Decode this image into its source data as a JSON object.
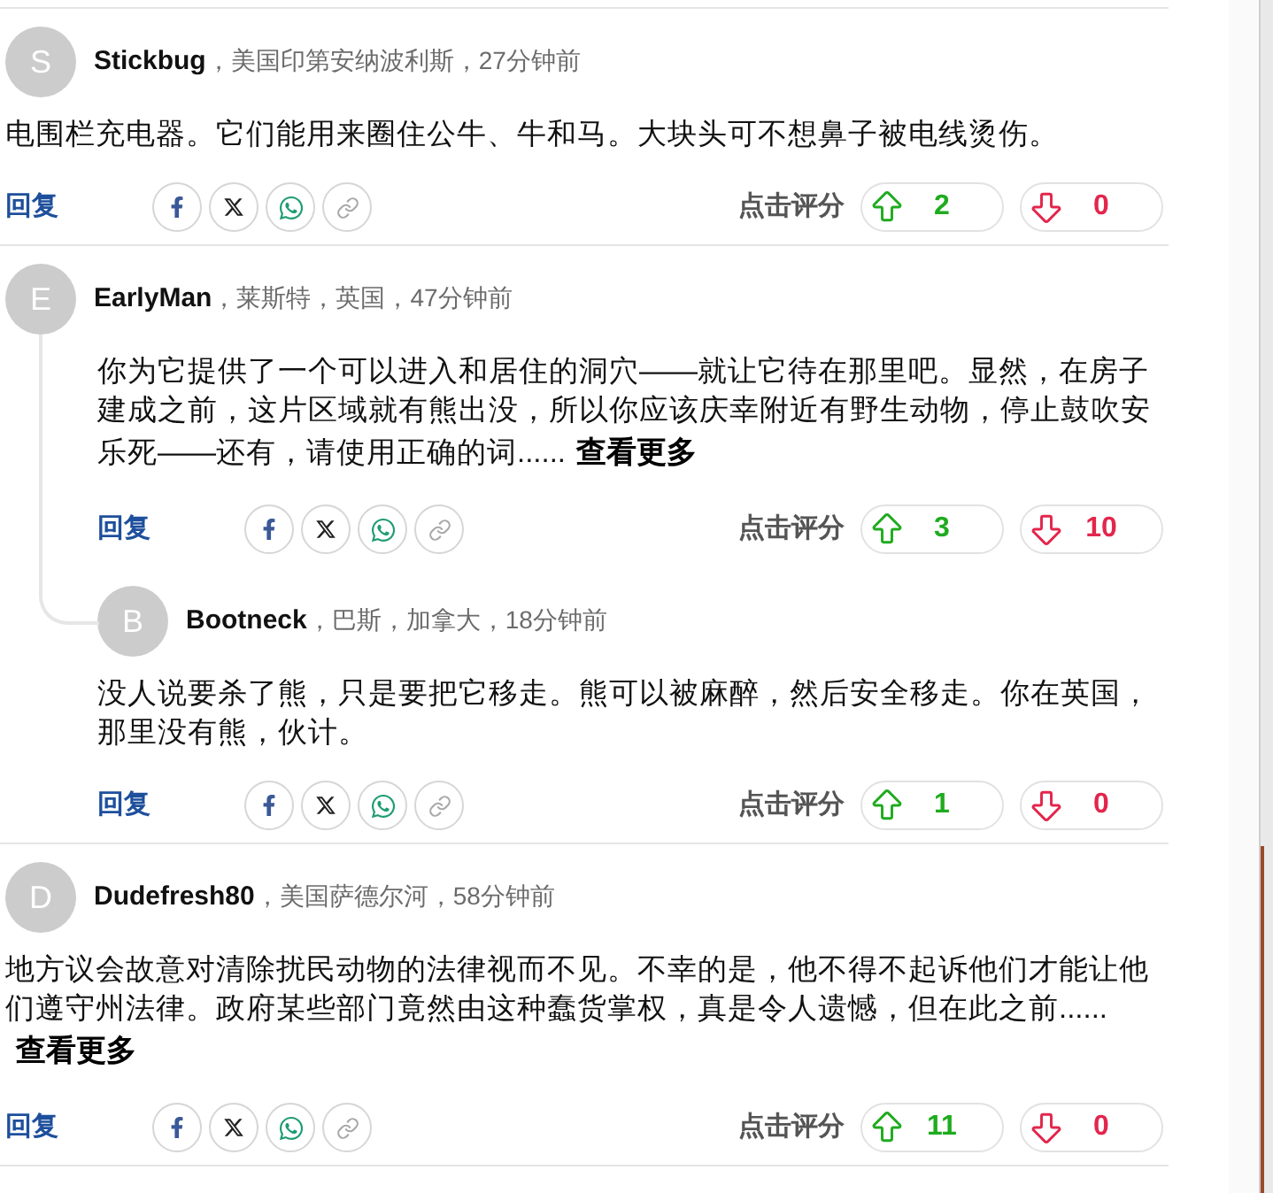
{
  "comments": [
    {
      "avatar": "S",
      "author": "Stickbug",
      "meta": "，美国印第安纳波利斯，27分钟前",
      "body": "电围栏充电器。它们能用来圈住公牛、牛和马。大块头可不想鼻子被电线烫伤。",
      "reply_label": "回复",
      "rate_label": "点击评分",
      "upvotes": "2",
      "downvotes": "0"
    },
    {
      "avatar": "E",
      "author": "EarlyMan",
      "meta": "，莱斯特，英国，47分钟前",
      "body": "你为它提供了一个可以进入和居住的洞穴——就让它待在那里吧。显然，在房子建成之前，这片区域就有熊出没，所以你应该庆幸附近有野生动物，停止鼓吹安乐死——还有，请使用正确的词......",
      "read_more": "查看更多",
      "reply_label": "回复",
      "rate_label": "点击评分",
      "upvotes": "3",
      "downvotes": "10",
      "replies": [
        {
          "avatar": "B",
          "author": "Bootneck",
          "meta": "，巴斯，加拿大，18分钟前",
          "body": "没人说要杀了熊，只是要把它移走。熊可以被麻醉，然后安全移走。你在英国，那里没有熊，伙计。",
          "reply_label": "回复",
          "rate_label": "点击评分",
          "upvotes": "1",
          "downvotes": "0"
        }
      ]
    },
    {
      "avatar": "D",
      "author": "Dudefresh80",
      "meta": "，美国萨德尔河，58分钟前",
      "body": "地方议会故意对清除扰民动物的法律视而不见。不幸的是，他不得不起诉他们才能让他们遵守州法律。政府某些部门竟然由这种蠢货掌权，真是令人遗憾，但在此之前......",
      "read_more": "查看更多",
      "reply_label": "回复",
      "rate_label": "点击评分",
      "upvotes": "11",
      "downvotes": "0"
    }
  ]
}
